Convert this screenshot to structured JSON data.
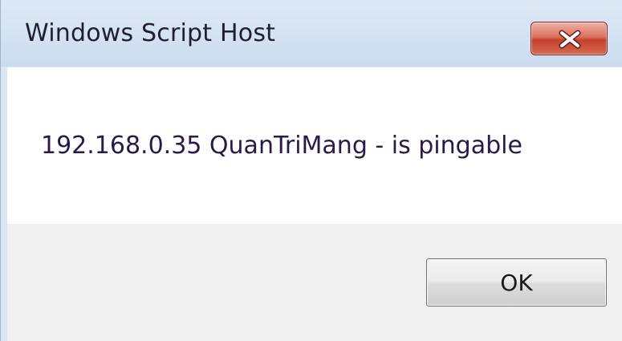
{
  "window": {
    "title": "Windows Script Host",
    "close_icon": "close-icon"
  },
  "message": {
    "text": "192.168.0.35 QuanTriMang - is pingable"
  },
  "buttons": {
    "ok_label": "OK"
  },
  "colors": {
    "titlebar": "#d3e2f2",
    "close_button": "#c4402c",
    "content_bg": "#ffffff",
    "footer_bg": "#f0f0f0"
  }
}
